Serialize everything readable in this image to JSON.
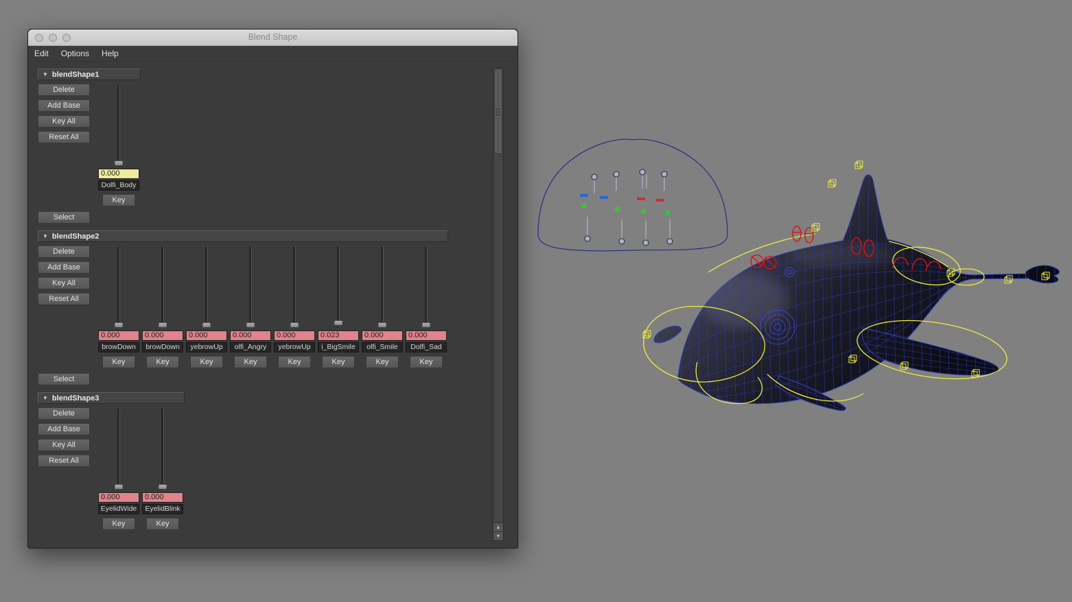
{
  "window": {
    "title": "Blend Shape",
    "menu": [
      "Edit",
      "Options",
      "Help"
    ]
  },
  "colors": {
    "value_yellow": "#efeb9c",
    "value_pink": "#e2828b",
    "wireframe_blue": "#2f41bb",
    "control_yellow": "#eded3c",
    "manipulator_red": "#e01010"
  },
  "panels": [
    {
      "name": "blendShape1",
      "buttons": [
        "Delete",
        "Add Base",
        "Key All",
        "Reset All"
      ],
      "key_label": "Key",
      "select_label": "Select",
      "sliders": [
        {
          "value": "0.000",
          "label": "Dolfi_Body",
          "bg": "#efeb9c"
        }
      ]
    },
    {
      "name": "blendShape2",
      "buttons": [
        "Delete",
        "Add Base",
        "Key All",
        "Reset All"
      ],
      "key_label": "Key",
      "select_label": "Select",
      "sliders": [
        {
          "value": "0.000",
          "label": "browDown",
          "bg": "#e2828b"
        },
        {
          "value": "0.000",
          "label": "browDown",
          "bg": "#e2828b"
        },
        {
          "value": "0.000",
          "label": "yebrowUp",
          "bg": "#e2828b"
        },
        {
          "value": "0.000",
          "label": "olfi_Angry",
          "bg": "#e2828b"
        },
        {
          "value": "0.000",
          "label": "yebrowUp",
          "bg": "#e2828b"
        },
        {
          "value": "0.023",
          "label": "i_BigSmile",
          "bg": "#e2828b"
        },
        {
          "value": "0.000",
          "label": "olfi_Smile",
          "bg": "#e2828b"
        },
        {
          "value": "0.000",
          "label": "Dolfi_Sad",
          "bg": "#e2828b"
        }
      ]
    },
    {
      "name": "blendShape3",
      "buttons": [
        "Delete",
        "Add Base",
        "Key All",
        "Reset All"
      ],
      "key_label": "Key",
      "sliders": [
        {
          "value": "0.000",
          "label": "EyelidWide",
          "bg": "#e2828b"
        },
        {
          "value": "0.000",
          "label": "EyelidBlink",
          "bg": "#e2828b"
        }
      ]
    }
  ],
  "scrollbar": {
    "up_glyph": "▲",
    "down_glyph": "▼"
  }
}
